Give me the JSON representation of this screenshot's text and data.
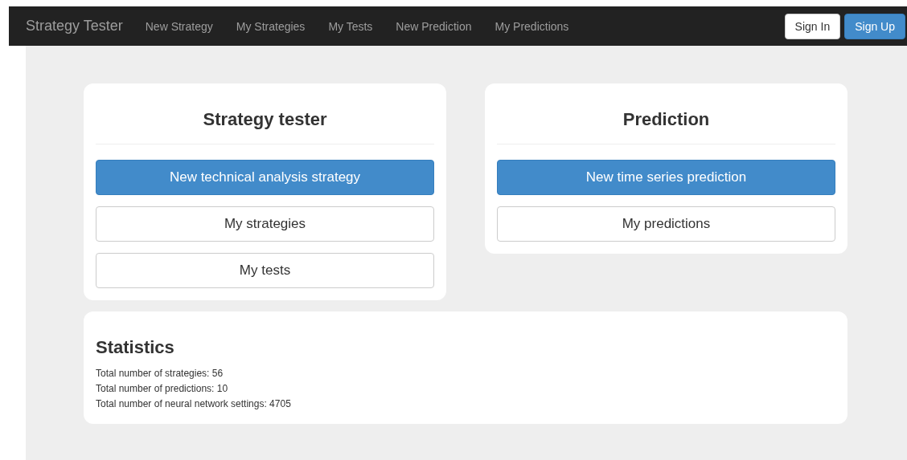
{
  "navbar": {
    "brand": "Strategy Tester",
    "links": [
      "New Strategy",
      "My Strategies",
      "My Tests",
      "New Prediction",
      "My Predictions"
    ],
    "buttons": [
      {
        "label": "Sign In",
        "kind": "default"
      },
      {
        "label": "Sign Up",
        "kind": "primary"
      }
    ]
  },
  "cards": [
    {
      "title": "Strategy tester",
      "buttons": [
        {
          "label": "New technical analysis strategy",
          "kind": "primary"
        },
        {
          "label": "My strategies",
          "kind": "default"
        },
        {
          "label": "My tests",
          "kind": "default"
        }
      ]
    },
    {
      "title": "Prediction",
      "buttons": [
        {
          "label": "New time series prediction",
          "kind": "primary"
        },
        {
          "label": "My predictions",
          "kind": "default"
        }
      ]
    }
  ],
  "statistics": {
    "title": "Statistics",
    "lines": [
      "Total number of strategies: 56",
      "Total number of predictions: 10",
      "Total number of neural network settings: 4705"
    ]
  }
}
